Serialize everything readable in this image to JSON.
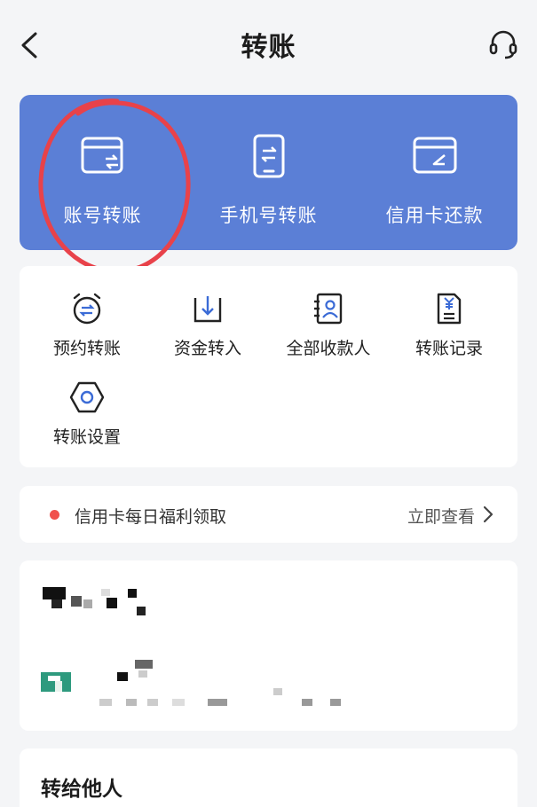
{
  "nav": {
    "title": "转账"
  },
  "quick_actions": [
    {
      "label": "账号转账",
      "icon": "card-transfer-icon"
    },
    {
      "label": "手机号转账",
      "icon": "phone-transfer-icon"
    },
    {
      "label": "信用卡还款",
      "icon": "credit-card-repay-icon"
    }
  ],
  "services": [
    {
      "label": "预约转账",
      "icon": "alarm-clock-transfer-icon"
    },
    {
      "label": "资金转入",
      "icon": "download-tray-icon"
    },
    {
      "label": "全部收款人",
      "icon": "contact-book-icon"
    },
    {
      "label": "转账记录",
      "icon": "yuan-document-icon"
    },
    {
      "label": "转账设置",
      "icon": "hexagon-settings-icon"
    }
  ],
  "promo": {
    "text": "信用卡每日福利领取",
    "action": "立即查看"
  },
  "transfer_others": {
    "title": "转给他人"
  },
  "colors": {
    "hero_bg": "#5b7fd6",
    "promo_dot": "#f0524d",
    "annotation": "#e8424a"
  }
}
